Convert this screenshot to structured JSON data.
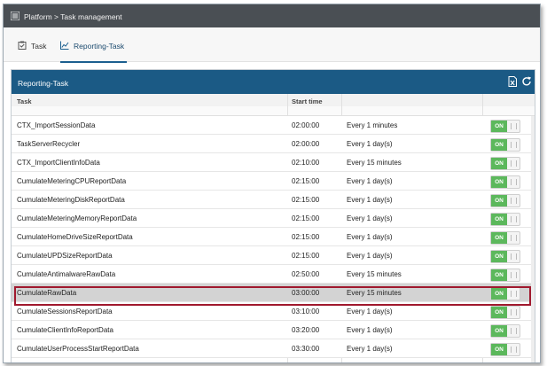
{
  "header": {
    "title": "Platform > Task management"
  },
  "tabs": [
    {
      "label": "Task",
      "icon": "clipboard-check-icon",
      "active": false
    },
    {
      "label": "Reporting-Task",
      "icon": "line-chart-icon",
      "active": true
    }
  ],
  "panel": {
    "title": "Reporting-Task",
    "actions": [
      "excel-export-icon",
      "refresh-icon"
    ]
  },
  "table": {
    "columns": [
      "Task",
      "Start time",
      "",
      ""
    ],
    "rows": [
      {
        "task": "CTX_ImportSessionData",
        "start": "02:00:00",
        "interval": "Every 1 minutes",
        "toggle": "ON"
      },
      {
        "task": "TaskServerRecycler",
        "start": "02:00:00",
        "interval": "Every 1 day(s)",
        "toggle": "ON"
      },
      {
        "task": "CTX_ImportClientInfoData",
        "start": "02:10:00",
        "interval": "Every 15 minutes",
        "toggle": "ON"
      },
      {
        "task": "CumulateMeteringCPUReportData",
        "start": "02:15:00",
        "interval": "Every 1 day(s)",
        "toggle": "ON"
      },
      {
        "task": "CumulateMeteringDiskReportData",
        "start": "02:15:00",
        "interval": "Every 1 day(s)",
        "toggle": "ON"
      },
      {
        "task": "CumulateMeteringMemoryReportData",
        "start": "02:15:00",
        "interval": "Every 1 day(s)",
        "toggle": "ON"
      },
      {
        "task": "CumulateHomeDriveSizeReportData",
        "start": "02:15:00",
        "interval": "Every 1 day(s)",
        "toggle": "ON"
      },
      {
        "task": "CumulateUPDSizeReportData",
        "start": "02:15:00",
        "interval": "Every 1 day(s)",
        "toggle": "ON"
      },
      {
        "task": "CumulateAntimalwareRawData",
        "start": "02:50:00",
        "interval": "Every 15 minutes",
        "toggle": "ON"
      },
      {
        "task": "CumulateRawData",
        "start": "03:00:00",
        "interval": "Every 15 minutes",
        "toggle": "ON",
        "selected": true
      },
      {
        "task": "CumulateSessionsReportData",
        "start": "03:10:00",
        "interval": "Every 1 day(s)",
        "toggle": "ON"
      },
      {
        "task": "CumulateClientInfoReportData",
        "start": "03:20:00",
        "interval": "Every 1 day(s)",
        "toggle": "ON"
      },
      {
        "task": "CumulateUserProcessStartReportData",
        "start": "03:30:00",
        "interval": "Every 1 day(s)",
        "toggle": "ON"
      }
    ]
  },
  "colors": {
    "topbar": "#4a4f54",
    "panel_header": "#1b5a85",
    "toggle_on": "#5cb85c",
    "highlight": "#a0192e",
    "selected_row": "#d3d3d3"
  }
}
